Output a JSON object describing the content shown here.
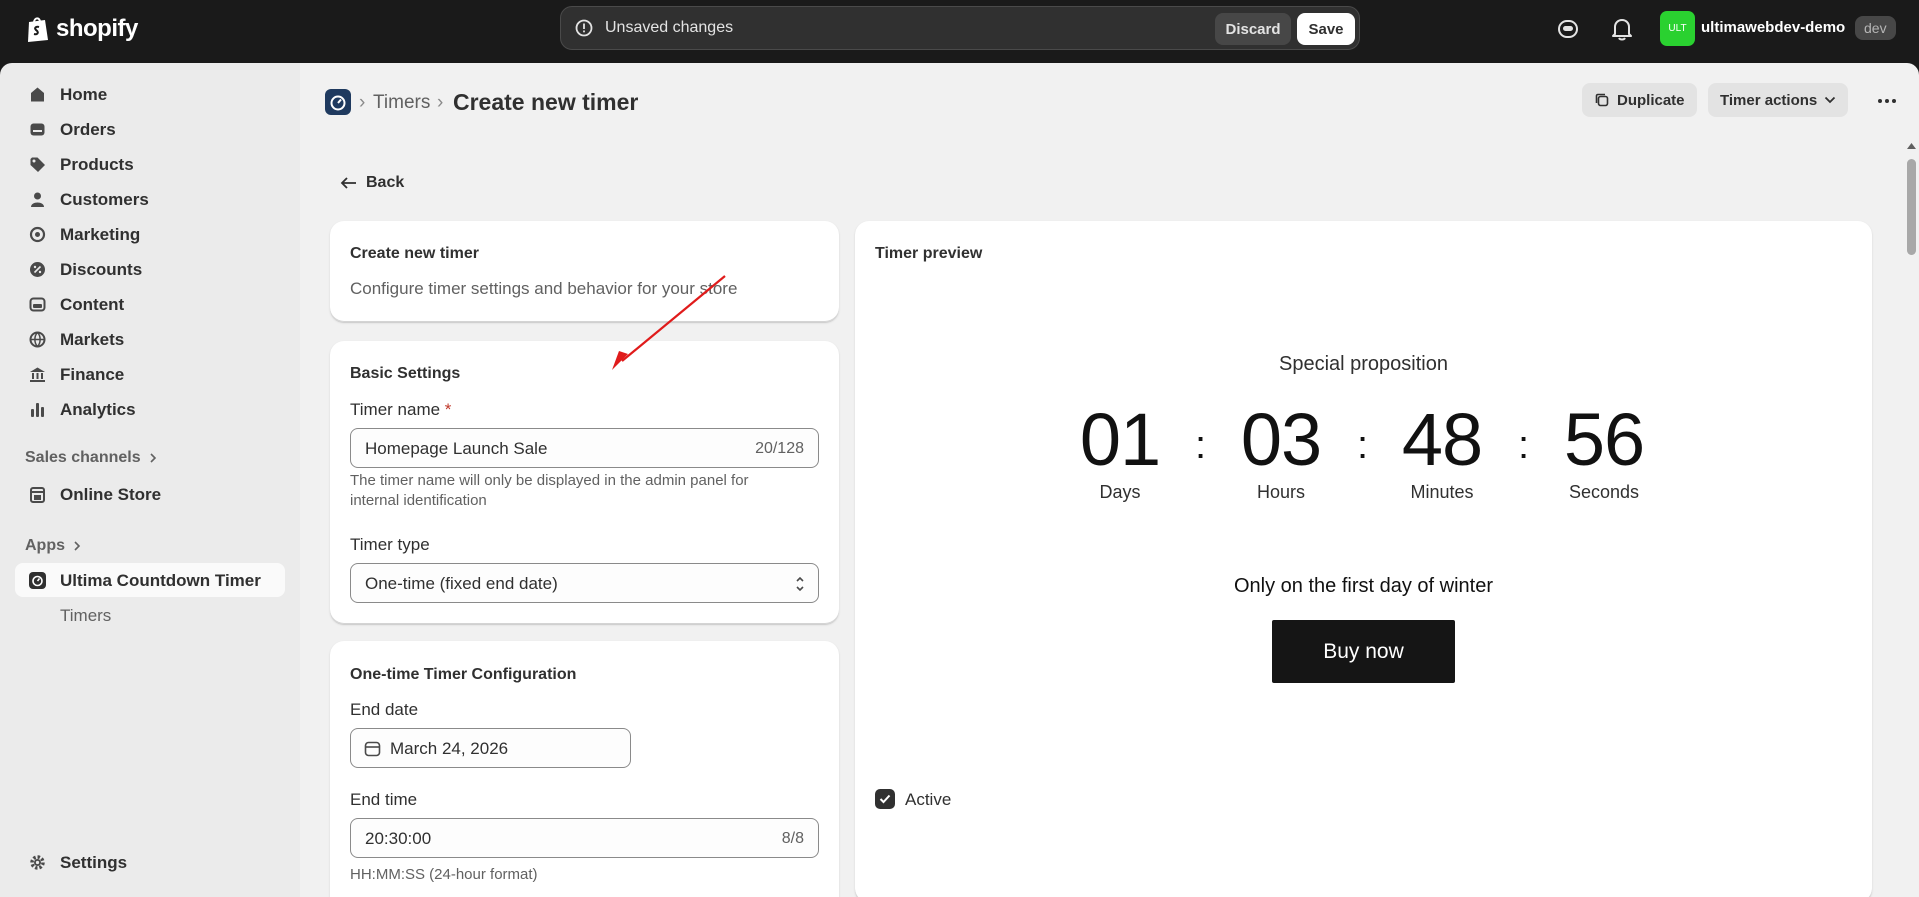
{
  "topbar": {
    "brand": "shopify",
    "unsaved_text": "Unsaved changes",
    "discard_label": "Discard",
    "save_label": "Save",
    "store_initials": "ULT",
    "store_name": "ultimawebdev-demo",
    "store_badge": "dev"
  },
  "sidebar": {
    "items": [
      {
        "label": "Home",
        "icon": "home-icon"
      },
      {
        "label": "Orders",
        "icon": "orders-icon"
      },
      {
        "label": "Products",
        "icon": "tag-icon"
      },
      {
        "label": "Customers",
        "icon": "person-icon"
      },
      {
        "label": "Marketing",
        "icon": "target-icon"
      },
      {
        "label": "Discounts",
        "icon": "discount-icon"
      },
      {
        "label": "Content",
        "icon": "image-icon"
      },
      {
        "label": "Markets",
        "icon": "globe-icon"
      },
      {
        "label": "Finance",
        "icon": "bank-icon"
      },
      {
        "label": "Analytics",
        "icon": "chart-bar-icon"
      }
    ],
    "sales_channels_label": "Sales channels",
    "online_store_label": "Online Store",
    "apps_label": "Apps",
    "app_label": "Ultima Countdown Timer",
    "app_sub_label": "Timers",
    "settings_label": "Settings"
  },
  "header": {
    "crumb": "Timers",
    "title": "Create new timer",
    "duplicate_label": "Duplicate",
    "actions_label": "Timer actions"
  },
  "back_label": "Back",
  "intro_card": {
    "title": "Create new timer",
    "description": "Configure timer settings and behavior for your store"
  },
  "basic_settings": {
    "title": "Basic Settings",
    "name_label": "Timer name",
    "name_required": "*",
    "name_value": "Homepage Launch Sale",
    "name_count": "20/128",
    "name_help_1": "The timer name will only be displayed in the admin panel for",
    "name_help_2": "internal identification",
    "type_label": "Timer type",
    "type_value": "One-time (fixed end date)"
  },
  "one_time_config": {
    "title": "One-time Timer Configuration",
    "end_date_label": "End date",
    "end_date_value": "March 24, 2026",
    "end_time_label": "End time",
    "end_time_value": "20:30:00",
    "end_time_count": "8/8",
    "end_time_help": "HH:MM:SS (24-hour format)"
  },
  "preview": {
    "title": "Timer preview",
    "headline": "Special proposition",
    "units": [
      {
        "value": "01",
        "label": "Days"
      },
      {
        "value": "03",
        "label": "Hours"
      },
      {
        "value": "48",
        "label": "Minutes"
      },
      {
        "value": "56",
        "label": "Seconds"
      }
    ],
    "separator": ":",
    "subtext": "Only on the first day of winter",
    "button_label": "Buy now",
    "active_label": "Active",
    "active_checked": true
  }
}
